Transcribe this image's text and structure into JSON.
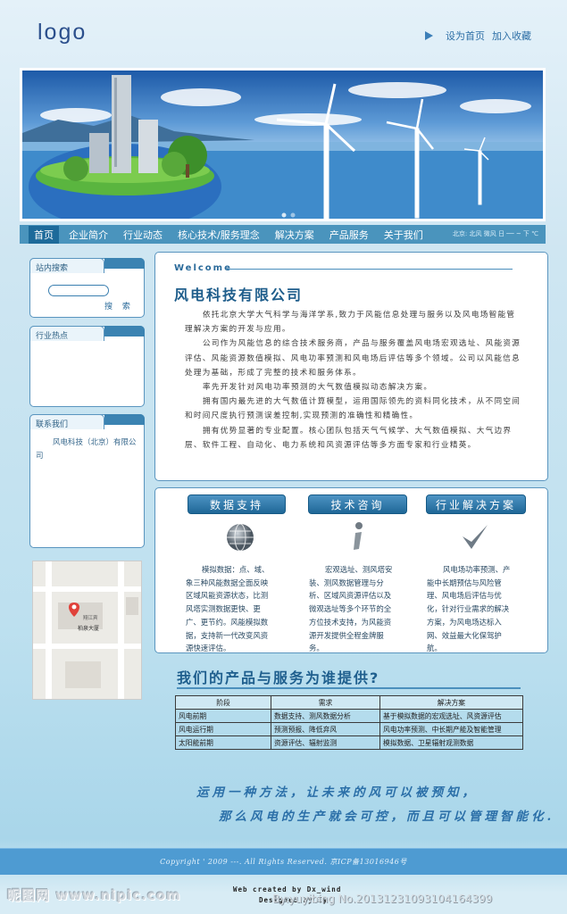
{
  "header": {
    "logo": "logo",
    "set_home": "设为首页",
    "add_favorite": "加入收藏"
  },
  "nav": {
    "items": [
      "首页",
      "企业简介",
      "行业动态",
      "核心技术/服务理念",
      "解决方案",
      "产品服务",
      "关于我们"
    ],
    "date": "北京: 北风 微风 日 ── ~ 下 ℃"
  },
  "sidebar": {
    "search": {
      "title": "站内搜索",
      "button": "搜 索"
    },
    "hot": {
      "title": "行业热点"
    },
    "contact": {
      "title": "联系我们",
      "text": "风电科技（北京）有限公司"
    },
    "map": {
      "label1": "翔江宾",
      "label2": "柏泉大厦"
    }
  },
  "welcome": {
    "title": "Welcome",
    "company": "风电科技有限公司",
    "paragraphs": [
      "依托北京大学大气科学与海洋学系,致力于风能信息处理与服务以及风电场智能管理解决方案的开发与应用。",
      "公司作为风能信息的综合技术服务商，产品与服务覆盖风电场宏观选址、风能资源评估、风能资源数值模拟、风电功率预测和风电场后评估等多个领域。公司以风能信息处理为基础，形成了完整的技术和服务体系。",
      "率先开发针对风电功率预测的大气数值模拟动态解决方案。",
      "拥有国内最先进的大气数值计算模型，运用国际领先的资料同化技术，从不同空间和时间尺度执行预测误差控制,实现预测的准确性和精确性。",
      "拥有优势显著的专业配置。核心团队包括天气气候学、大气数值模拟、大气边界层、软件工程、自动化、电力系统和风资源评估等多方面专家和行业精英。"
    ]
  },
  "services": [
    {
      "title": "数据支持",
      "icon": "globe-icon",
      "text": "模拟数据：点、域、象三种风能数据全面反映区域风能资源状态，比测风塔实测数据更快、更广、更节约。风能模拟数据，支持新一代改变风资源快速评估。"
    },
    {
      "title": "技术咨询",
      "icon": "info-icon",
      "text": "宏观选址、测风塔安装、测风数据管理与分析、区域风资源评估以及微观选址等多个环节的全方位技术支持，为风能资源开发提供全程金牌服务。"
    },
    {
      "title": "行业解决方案",
      "icon": "checkmark-icon",
      "text": "风电场功率预测、产能中长期预估与风险管理、风电场后评估与优化，针对行业需求的解决方案，为风电场达标入网、效益最大化保驾护航。"
    }
  ],
  "products": {
    "title": "我们的产品与服务为谁提供?",
    "headers": [
      "阶段",
      "需求",
      "解决方案"
    ],
    "rows": [
      [
        "风电前期",
        "数据支持、测风数据分析",
        "基于模拟数据的宏观选址、风资源评估"
      ],
      [
        "风电运行期",
        "预测预报、降低弃风",
        "风电功率预测、中长期产能及智能管理"
      ],
      [
        "太阳能前期",
        "资源评估、辐射监测",
        "模拟数据、卫星辐射观测数据"
      ]
    ]
  },
  "slogan": {
    "line1": "运用一种方法，让未来的风可以被预知，",
    "line2": "那么风电的生产就会可控，而且可以管理智能化."
  },
  "footer": {
    "copyright": "Copyright ' 2009 ---. All Rights Reserved. 京ICP备13016946号",
    "credit1": "Web created by Dx_wind",
    "credit2": "Designed by Iy"
  },
  "watermark": {
    "left": "昵图网 www.nipic.com",
    "right": "By:yuyibing No.20131231093104164399"
  },
  "colors": {
    "accent": "#4a94bd",
    "dark": "#1f6797",
    "title": "#1e5d8b"
  }
}
